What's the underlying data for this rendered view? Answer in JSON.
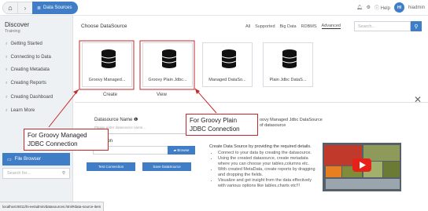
{
  "topbar": {
    "home_icon": "home-icon",
    "breadcrumb_active": "Data Sources",
    "help": "Help",
    "user_initials": "HI",
    "user_name": "hiadmin"
  },
  "sidebar": {
    "title": "Discover",
    "subtitle": "Training",
    "items": [
      {
        "label": "Getting Started",
        "icon": "bulb-icon"
      },
      {
        "label": "Connecting to Data",
        "icon": "bulb-icon"
      },
      {
        "label": "Creating Metadata",
        "icon": "bulb-icon"
      },
      {
        "label": "Creating Reports",
        "icon": "bulb-icon"
      },
      {
        "label": "Creating Dashboard",
        "icon": "bulb-icon"
      },
      {
        "label": "Learn More",
        "icon": "bulb-icon"
      }
    ],
    "file_browser": "File Browser",
    "search_placeholder": "Search for..."
  },
  "main": {
    "title": "Choose DataSource",
    "filters": [
      "All",
      "Supported",
      "Big Data",
      "RDBMS",
      "Advanced"
    ],
    "search_placeholder": "Search...",
    "cards": [
      {
        "label": "Groovy Managed..."
      },
      {
        "label": "Groovy Plain Jdbc..."
      },
      {
        "label": "Managed DataSo..."
      },
      {
        "label": "Plain Jdbc DataS..."
      }
    ],
    "tabs": [
      "Create",
      "View"
    ],
    "form": {
      "name_label": "Datasource Name",
      "name_placeholder": "Please enter datasource name...",
      "location_label": "ation",
      "browse": "Browse",
      "test": "Test Connection",
      "save": "Save DataSource"
    },
    "description_line1": "oovy Managed Jdbc DataSource",
    "description_line2": "of datasource",
    "info_head": "Create Data Source by providing the required details.",
    "info_list": [
      "Connect to your data by creating the datasource.",
      "Using the created datasource, create metadata where you can choose your tables,columns etc.",
      "With created MetaData, create reports by dragging and dropping the fields.",
      "Visualize and get insight from the data effectively with various options like tables,charts etc!!!"
    ]
  },
  "callouts": {
    "managed_line1": "For Groovy Managed",
    "managed_line2": "JDBC Connection",
    "plain_line1": "For Groovy Plain",
    "plain_line2": "JDBC Connection"
  },
  "statusbar": "localhost:8011/hi-ee/admin/datasources.html#data-source-item",
  "colors": {
    "accent": "#3f7dc6",
    "callout_border": "#c62828"
  }
}
